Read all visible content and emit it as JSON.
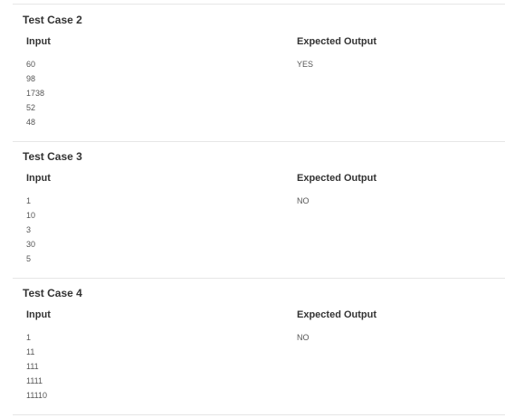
{
  "test_cases": [
    {
      "title": "Test Case 2",
      "input_header": "Input",
      "output_header": "Expected Output",
      "inputs": [
        "60",
        "98",
        "1738",
        "52",
        "48"
      ],
      "output": "YES"
    },
    {
      "title": "Test Case 3",
      "input_header": "Input",
      "output_header": "Expected Output",
      "inputs": [
        "1",
        "10",
        "3",
        "30",
        "5"
      ],
      "output": "NO"
    },
    {
      "title": "Test Case 4",
      "input_header": "Input",
      "output_header": "Expected Output",
      "inputs": [
        "1",
        "11",
        "111",
        "1111",
        "11110"
      ],
      "output": "NO"
    }
  ]
}
